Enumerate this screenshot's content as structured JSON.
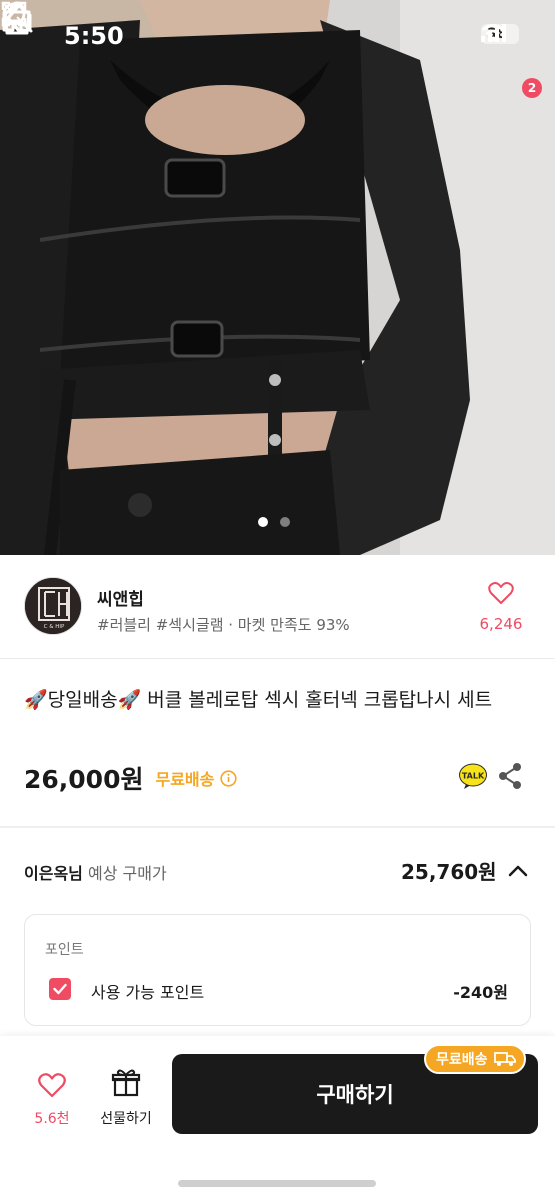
{
  "status_bar": {
    "time": "5:50",
    "battery": "38"
  },
  "nav": {
    "cart_badge": "2"
  },
  "gallery": {
    "pages": 2,
    "active_page": 1
  },
  "seller": {
    "name": "씨앤힙",
    "avatar_text": "C & HIP",
    "tags": "#러블리 #섹시글램 · 마켓 만족도 93%",
    "wish_count": "6,246"
  },
  "product": {
    "title": "🚀당일배송🚀 버클 볼레로탑 섹시 홀터넥 크롭탑나시 세트",
    "price": "26,000원",
    "shipping": "무료배송"
  },
  "expected": {
    "user": "이은옥님",
    "label": "예상 구매가",
    "price": "25,760원"
  },
  "points": {
    "title": "포인트",
    "option_label": "사용 가능 포인트",
    "value": "-240원",
    "checked": true
  },
  "bottom_bar": {
    "like_count": "5.6천",
    "gift_label": "선물하기",
    "buy_label": "구매하기",
    "shipping_chip": "무료배송"
  },
  "colors": {
    "accent_pink": "#ef4b63",
    "shipping_orange": "#f5a623",
    "buy_button": "#1a1a1a"
  }
}
